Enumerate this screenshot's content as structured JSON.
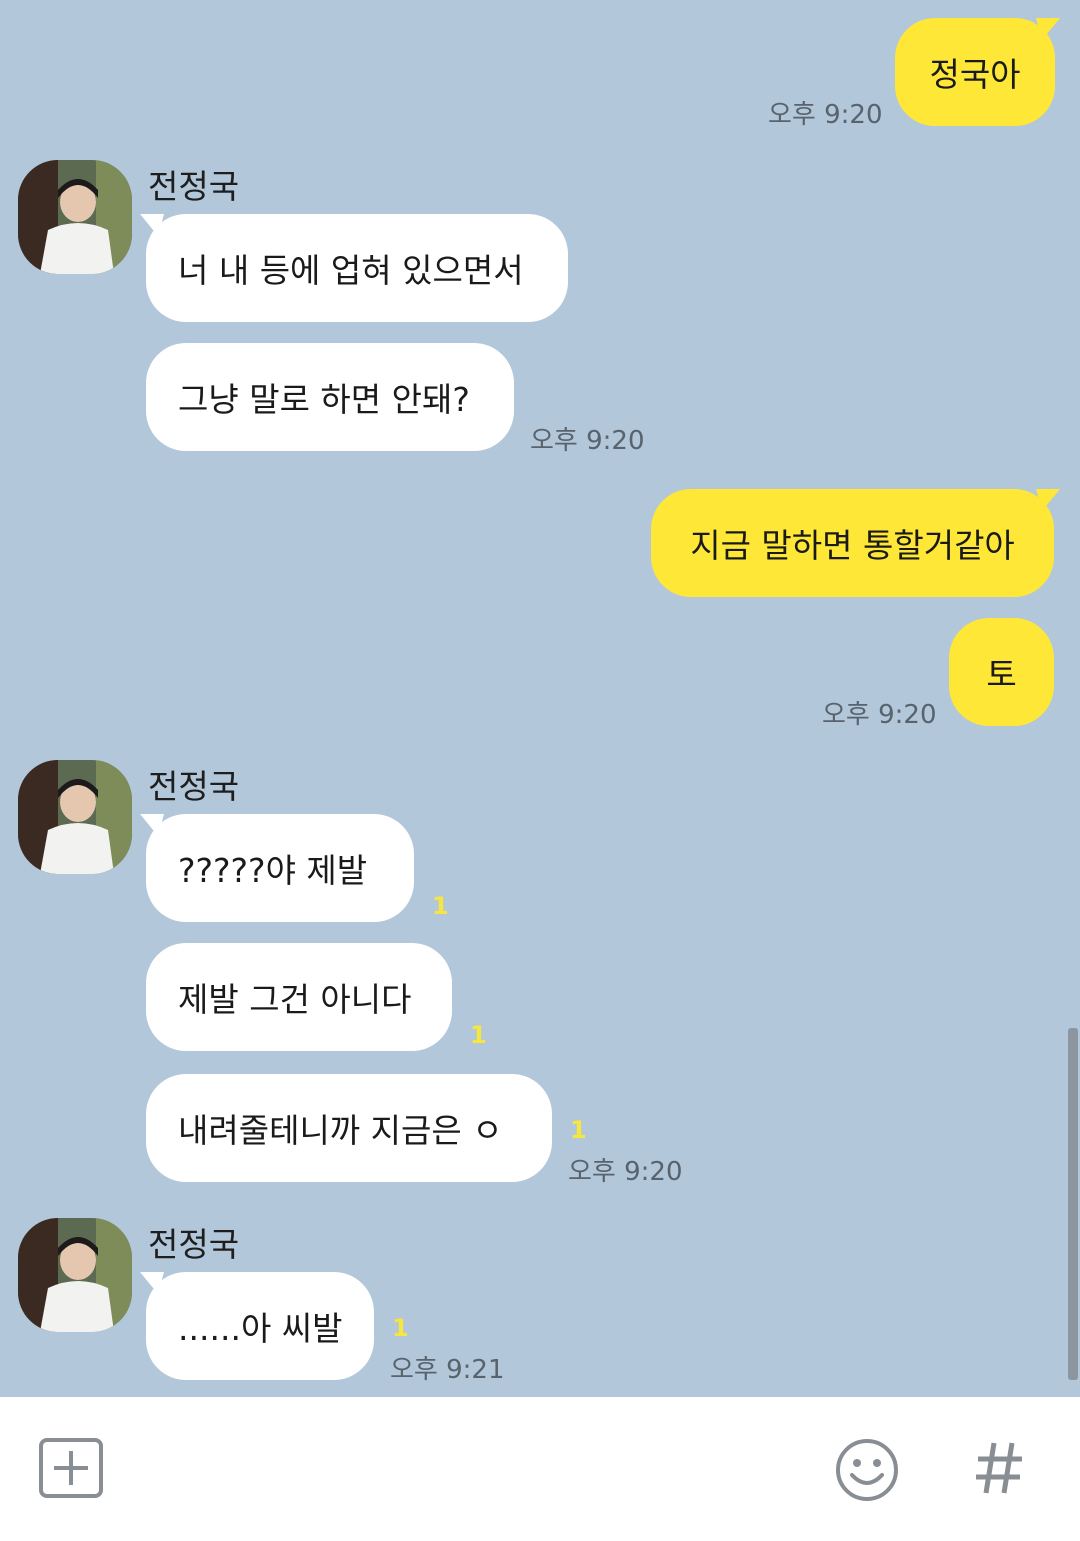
{
  "messages": {
    "m1": "정국아",
    "m2": "너 내 등에 업혀 있으면서",
    "m3": "그냥 말로 하면 안돼?",
    "m4": "지금 말하면 통할거같아",
    "m5": "토",
    "m6": "?????야 제발",
    "m7": "제발 그건 아니다",
    "m8": "내려줄테니까 지금은 ㅇ",
    "m9": "......아 씨발"
  },
  "sender": {
    "name": "전정국"
  },
  "times": {
    "t1": "오후 9:20",
    "t2": "오후 9:20",
    "t3": "오후 9:20",
    "t4": "오후 9:20",
    "t5": "오후 9:21"
  },
  "unread": {
    "u1": "1",
    "u2": "1",
    "u3": "1",
    "u4": "1"
  },
  "icons": {
    "add": "plus-square-icon",
    "emoji": "smiley-icon",
    "hashtag": "hashtag-icon"
  },
  "colors": {
    "background": "#b2c7da",
    "outgoing": "#fee737",
    "incoming": "#ffffff",
    "unread": "#f7e63c"
  }
}
